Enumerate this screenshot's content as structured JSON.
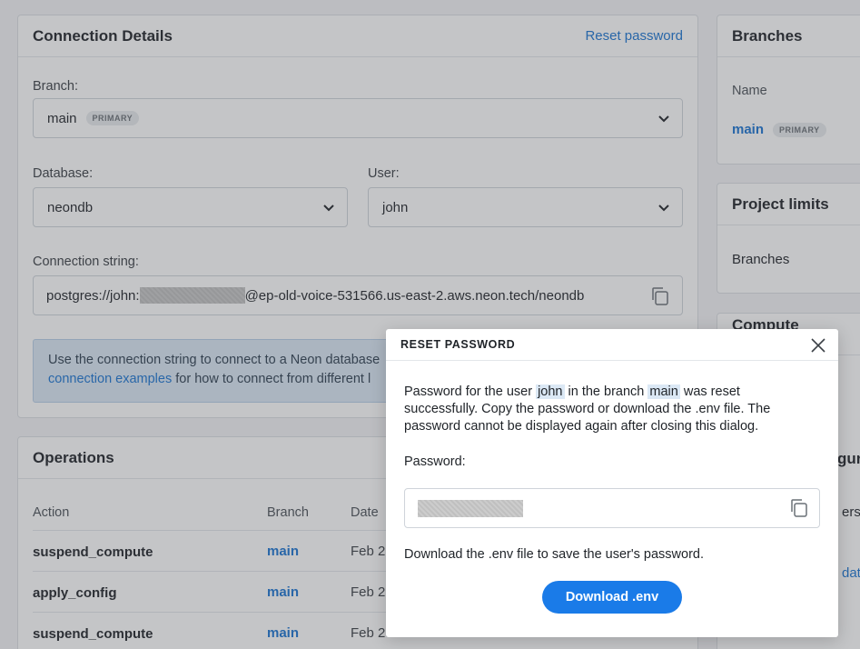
{
  "connection_details": {
    "title": "Connection Details",
    "reset_link": "Reset password",
    "branch_label": "Branch:",
    "branch_value": "main",
    "branch_badge": "PRIMARY",
    "database_label": "Database:",
    "database_value": "neondb",
    "user_label": "User:",
    "user_value": "john",
    "conn_label": "Connection string:",
    "conn_prefix": "postgres://john:",
    "conn_suffix": "@ep-old-voice-531566.us-east-2.aws.neon.tech/neondb",
    "info_text": "Use the connection string to connect to a Neon database",
    "info_link": "connection examples",
    "info_text2": " for how to connect from different l"
  },
  "operations": {
    "title": "Operations",
    "columns": [
      "Action",
      "Branch",
      "Date"
    ],
    "rows": [
      {
        "action": "suspend_compute",
        "branch": "main",
        "date": "Feb 2"
      },
      {
        "action": "apply_config",
        "branch": "main",
        "date": "Feb 2"
      },
      {
        "action": "suspend_compute",
        "branch": "main",
        "date": "Feb 2"
      }
    ]
  },
  "branches": {
    "title": "Branches",
    "col_name": "Name",
    "row_name": "main",
    "row_badge": "PRIMARY"
  },
  "project_limits": {
    "title": "Project limits",
    "row": "Branches"
  },
  "right_partial": {
    "compute_title": "Compute endpoint",
    "row_a": "gura",
    "row_b": "ersio",
    "row_c": "data"
  },
  "modal": {
    "title": "RESET PASSWORD",
    "msg_1": "Password for the user ",
    "user": "john",
    "msg_2": " in the branch ",
    "branch": "main",
    "msg_3": " was reset successfully. Copy the password or download the .env file. The password cannot be displayed again after closing this dialog.",
    "password_label": "Password:",
    "note": "Download the .env file to save the user's password.",
    "download_label": "Download .env"
  }
}
